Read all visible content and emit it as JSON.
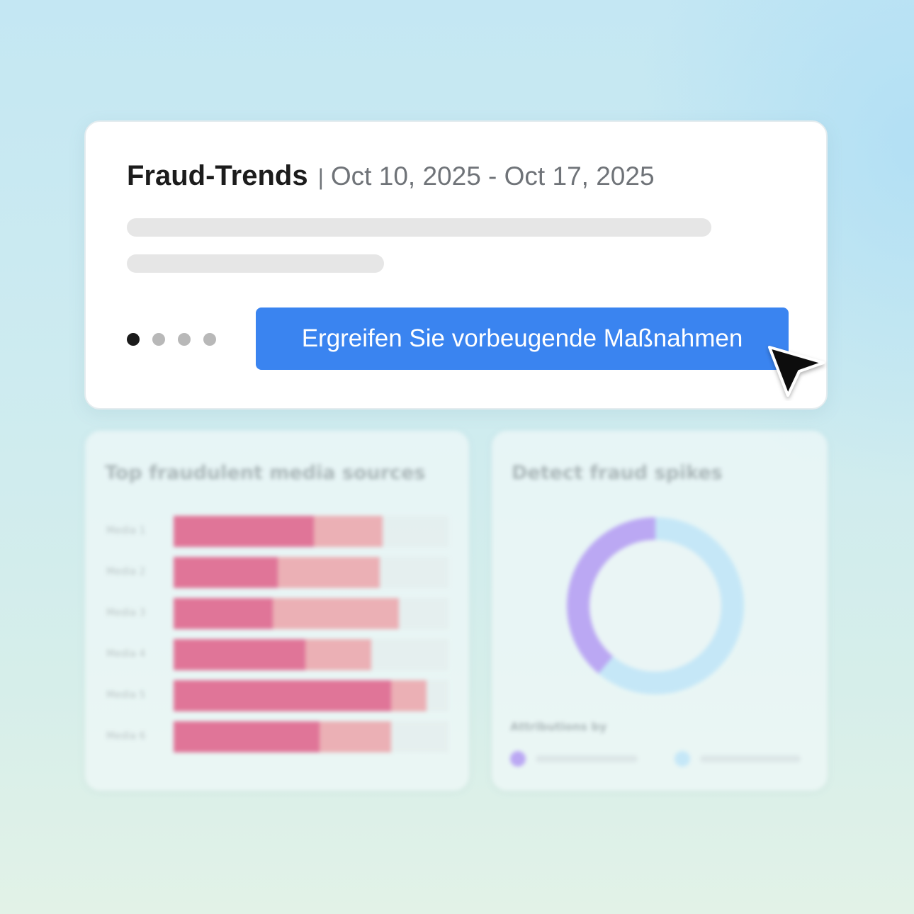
{
  "card": {
    "title": "Fraud-Trends",
    "separator": "|",
    "date_range": "Oct 10, 2025 - Oct 17, 2025",
    "carousel": {
      "count": 4,
      "active_index": 0
    },
    "cta_label": "Ergreifen Sie vorbeugende Maßnahmen"
  },
  "background_panels": {
    "sources": {
      "title": "Top fraudulent media sources",
      "rows": [
        {
          "label": "Media 1",
          "primary": 51,
          "secondary": 25
        },
        {
          "label": "Media 2",
          "primary": 38,
          "secondary": 37
        },
        {
          "label": "Media 3",
          "primary": 36,
          "secondary": 46
        },
        {
          "label": "Media 4",
          "primary": 48,
          "secondary": 24
        },
        {
          "label": "Media 5",
          "primary": 79,
          "secondary": 13
        },
        {
          "label": "Media 6",
          "primary": 53,
          "secondary": 26
        }
      ],
      "colors": {
        "primary": "#e07598",
        "secondary": "#ebb0b5"
      }
    },
    "spikes": {
      "title": "Detect fraud spikes",
      "donut": {
        "segments": [
          {
            "value": 61,
            "color": "#c5e7f7"
          },
          {
            "value": 39,
            "color": "#bba8f3"
          }
        ]
      },
      "legend_title": "Attributions by",
      "legend_colors": [
        "#bba8f3",
        "#c5e7f7"
      ]
    }
  },
  "colors": {
    "accent": "#3a84f0"
  },
  "icons": {
    "cursor": "mouse-pointer-icon"
  }
}
